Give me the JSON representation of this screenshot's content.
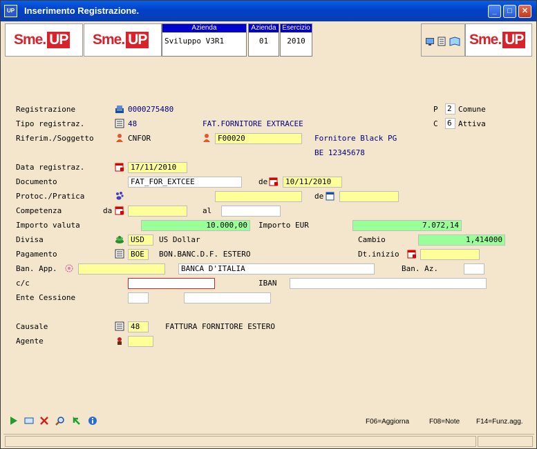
{
  "window": {
    "title": "Inserimento Registrazione.",
    "app_icon": "UP"
  },
  "header": {
    "logo_text": "Sme.",
    "logo_up": "UP",
    "azienda_label": "Azienda",
    "azienda_value": "Sviluppo V3R1",
    "azienda2_label": "Azienda",
    "azienda2_value": "01",
    "esercizio_label": "Esercizio",
    "esercizio_value": "2010"
  },
  "form": {
    "registrazione_label": "Registrazione",
    "registrazione_value": "0000275480",
    "p_label": "P",
    "p_value": "2",
    "p_desc": "Comune",
    "tipo_label": "Tipo registraz.",
    "tipo_value": "48",
    "tipo_desc": "FAT.FORNITORE EXTRACEE",
    "c_label": "C",
    "c_value": "6",
    "c_desc": "Attiva",
    "riferim_label": "Riferim./Soggetto",
    "riferim_code": "CNFOR",
    "soggetto_value": "F00020",
    "soggetto_name": "Fornitore Black PG",
    "soggetto_vat": "BE 12345678",
    "data_reg_label": "Data registraz.",
    "data_reg_value": "17/11/2010",
    "documento_label": "Documento",
    "documento_value": "FAT_FOR_EXTCEE",
    "doc_de_label": "de",
    "doc_date_value": "10/11/2010",
    "protoc_label": "Protoc./Pratica",
    "protoc_de_label": "de",
    "competenza_label": "Competenza",
    "comp_da_label": "da",
    "comp_al_label": "al",
    "importo_valuta_label": "Importo valuta",
    "importo_valuta_value": "10.000,00",
    "importo_eur_label": "Importo  EUR",
    "importo_eur_value": "7.072,14",
    "divisa_label": "Divisa",
    "divisa_value": "USD",
    "divisa_desc": "US Dollar",
    "cambio_label": "Cambio",
    "cambio_value": "1,414000",
    "pagamento_label": "Pagamento",
    "pagamento_value": "BOE",
    "pagamento_desc": "BON.BANC.D.F. ESTERO",
    "dt_inizio_label": "Dt.inizio",
    "ban_app_label": "Ban. App.",
    "ban_app_desc": "BANCA D'ITALIA",
    "ban_az_label": "Ban. Az.",
    "cc_label": "c/c",
    "iban_label": "IBAN",
    "ente_label": "Ente Cessione",
    "causale_label": "Causale",
    "causale_value": "48",
    "causale_desc": "FATTURA FORNITORE ESTERO",
    "agente_label": "Agente"
  },
  "footer": {
    "f06": "F06=Aggiorna",
    "f08": "F08=Note",
    "f14": "F14=Funz.agg."
  },
  "colors": {
    "title_blue": "#0040c8",
    "field_yellow": "#ffff99",
    "field_green": "#99ff99",
    "background": "#f3e6cc",
    "brand_red": "#d8232a"
  }
}
